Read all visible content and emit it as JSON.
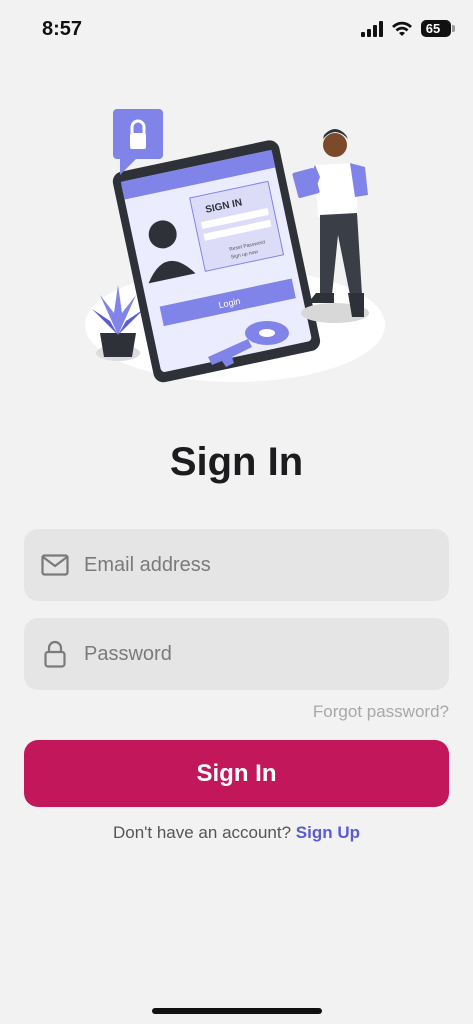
{
  "status_bar": {
    "time": "8:57",
    "battery": "65"
  },
  "illustration": {
    "screen_title": "SIGN IN",
    "screen_button": "Login",
    "screen_link_1": "Reset Password",
    "screen_link_2": "Sign up now"
  },
  "title": "Sign In",
  "email": {
    "placeholder": "Email address",
    "value": ""
  },
  "password": {
    "placeholder": "Password",
    "value": ""
  },
  "forgot_label": "Forgot password?",
  "signin_label": "Sign In",
  "signup": {
    "prompt": "Don't have an account?",
    "link": "Sign Up"
  },
  "colors": {
    "primary": "#c2185b",
    "accent": "#5b5bd6",
    "background": "#f2f2f2",
    "illustration_purple": "#8083e8"
  }
}
